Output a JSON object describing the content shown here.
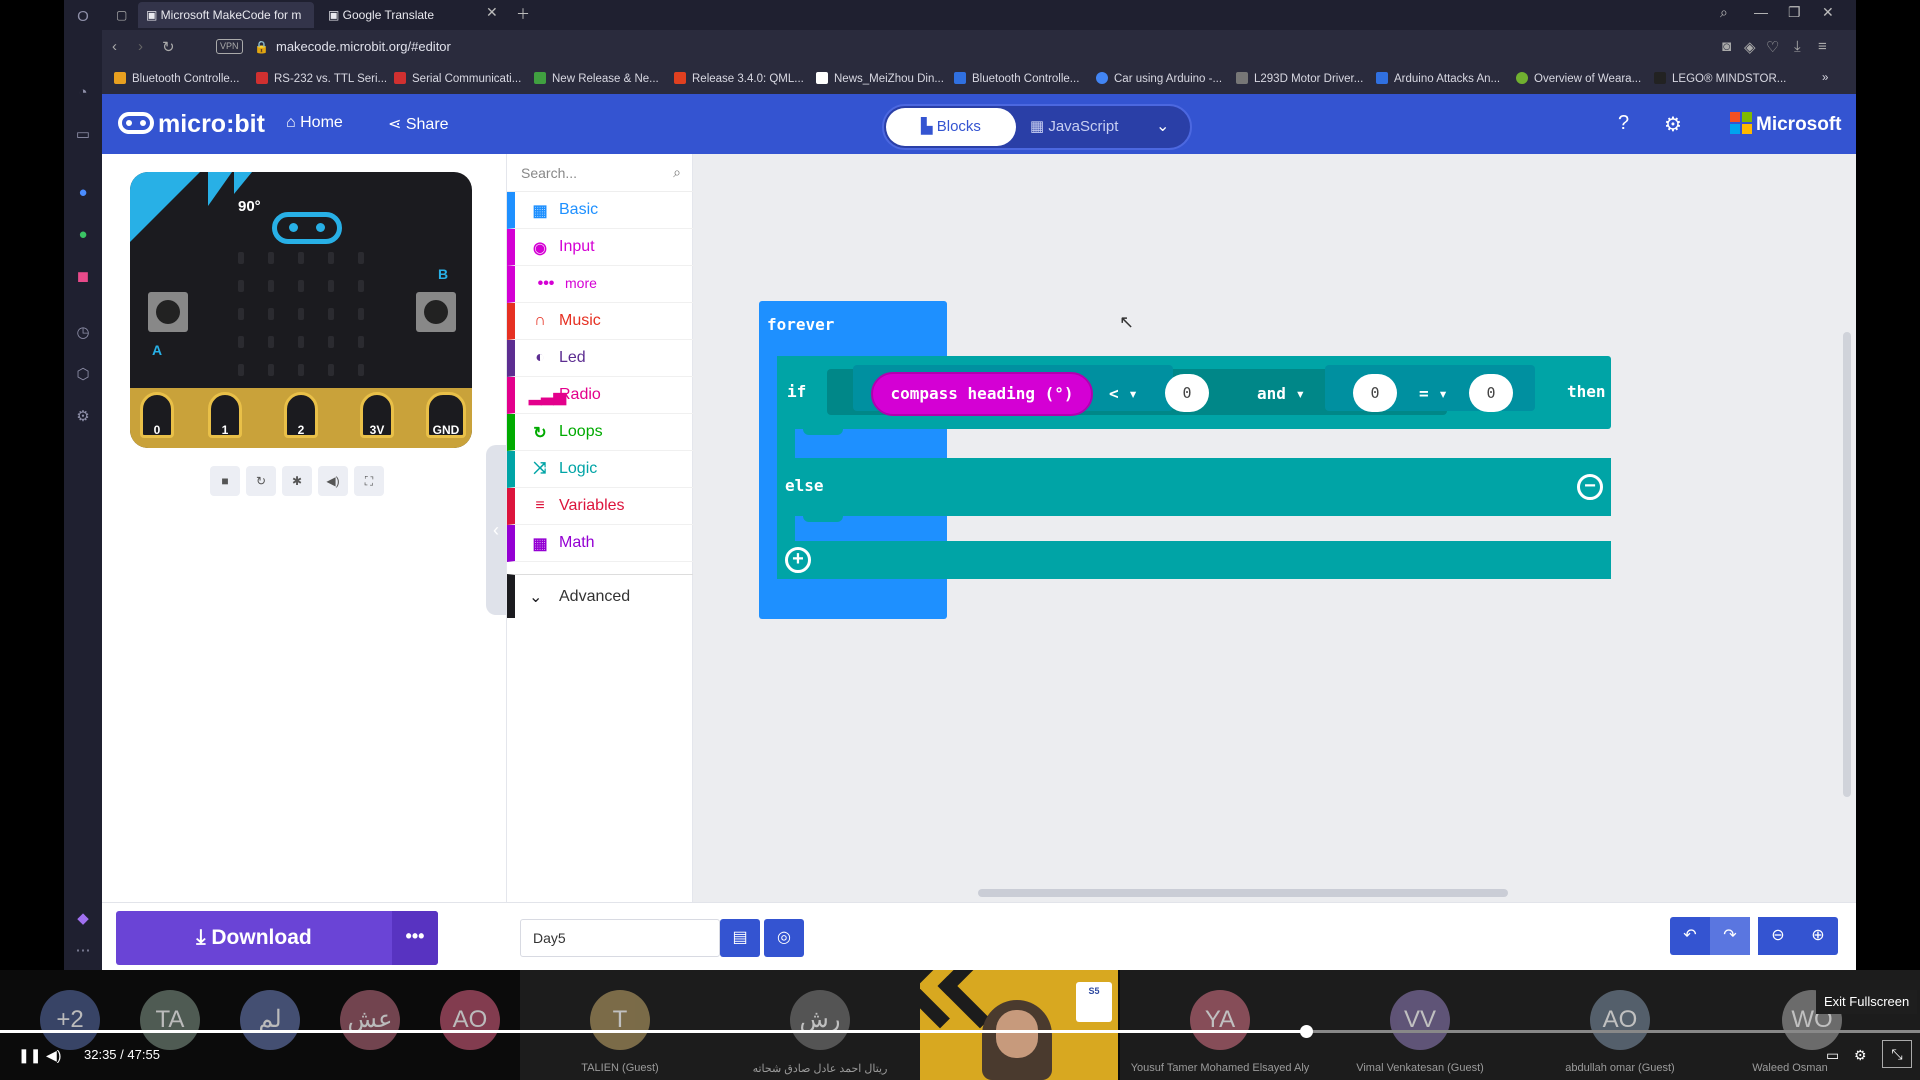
{
  "browser": {
    "tabs": [
      {
        "title": "Microsoft MakeCode for m",
        "active": true
      },
      {
        "title": "Google Translate",
        "active": false
      }
    ],
    "address": "makecode.microbit.org/#editor",
    "vpn_label": "VPN",
    "bookmarks": [
      {
        "label": "Bluetooth Controlle...",
        "color": "#e8a020"
      },
      {
        "label": "RS-232 vs. TTL Seri...",
        "color": "#d03030"
      },
      {
        "label": "Serial Communicati...",
        "color": "#d03030"
      },
      {
        "label": "New Release & Ne...",
        "color": "#40a040"
      },
      {
        "label": "Release 3.4.0: QML...",
        "color": "#e04020"
      },
      {
        "label": "News_MeiZhou Din...",
        "color": "#ffffff"
      },
      {
        "label": "Bluetooth Controlle...",
        "color": "#3070e0"
      },
      {
        "label": "Car using Arduino -...",
        "color": "#4285f4"
      },
      {
        "label": "L293D Motor Driver...",
        "color": "#777777"
      },
      {
        "label": "Arduino Attacks An...",
        "color": "#3070e0"
      },
      {
        "label": "Overview of Weara...",
        "color": "#70b030"
      },
      {
        "label": "LEGO® MINDSTOR...",
        "color": "#222222"
      }
    ]
  },
  "header": {
    "logo": "micro:bit",
    "home": "Home",
    "share": "Share",
    "blocks": "Blocks",
    "javascript": "JavaScript",
    "microsoft": "Microsoft"
  },
  "simulator": {
    "heading": "90°",
    "pins": [
      "0",
      "1",
      "2",
      "3V",
      "GND"
    ],
    "button_a": "A",
    "button_b": "B"
  },
  "toolbox": {
    "search_placeholder": "Search...",
    "categories": [
      {
        "label": "Basic",
        "icon": "grid-icon",
        "color": "#1e90ff"
      },
      {
        "label": "Input",
        "icon": "target-icon",
        "color": "#d400d4"
      },
      {
        "label": "more",
        "icon": "dots-icon",
        "color": "#d400d4"
      },
      {
        "label": "Music",
        "icon": "headphones-icon",
        "color": "#e63022"
      },
      {
        "label": "Led",
        "icon": "toggle-icon",
        "color": "#5c2d91"
      },
      {
        "label": "Radio",
        "icon": "signal-bars-icon",
        "color": "#e3008c"
      },
      {
        "label": "Loops",
        "icon": "loop-arrow-icon",
        "color": "#00aa00"
      },
      {
        "label": "Logic",
        "icon": "shuffle-icon",
        "color": "#00a4a6"
      },
      {
        "label": "Variables",
        "icon": "list-icon",
        "color": "#dc143c"
      },
      {
        "label": "Math",
        "icon": "calculator-icon",
        "color": "#9400d3"
      }
    ],
    "advanced": "Advanced"
  },
  "workspace": {
    "forever": "forever",
    "if": "if",
    "compass": "compass heading (°)",
    "op_lt": "<",
    "lhs_value": "0",
    "and": "and",
    "eq_left": "0",
    "op_eq": "=",
    "eq_right": "0",
    "then": "then",
    "else": "else"
  },
  "bottom": {
    "download": "Download",
    "project_name": "Day5"
  },
  "conference": {
    "participants": [
      {
        "initials": "+2",
        "name": "",
        "color": "#4a5a8a"
      },
      {
        "initials": "TA",
        "name": "",
        "color": "#6a7a70"
      },
      {
        "initials": "لم",
        "name": "",
        "color": "#5a6a9a"
      },
      {
        "initials": "عش",
        "name": "",
        "color": "#9a5a6a"
      },
      {
        "initials": "AO",
        "name": "",
        "color": "#b0506a"
      },
      {
        "initials": "T",
        "name": "TALIEN (Guest)",
        "color": "#a08a5a"
      },
      {
        "initials": "رش",
        "name": "ريتال احمد عادل صادق شحاته",
        "color": "#6a6a6a"
      },
      {
        "initials": "YA",
        "name": "Yousuf Tamer Mohamed Elsayed Aly",
        "color": "#b06070"
      },
      {
        "initials": "VV",
        "name": "Vimal Venkatesan (Guest)",
        "color": "#7a6a9a"
      },
      {
        "initials": "AO",
        "name": "abdullah omar (Guest)",
        "color": "#6a7a8a"
      },
      {
        "initials": "WO",
        "name": "Waleed Osman",
        "color": "#8a8a8a"
      }
    ],
    "time_current": "32:35",
    "time_sep": "/",
    "time_total": "47:55",
    "progress": 0.68,
    "tooltip": "Exit Fullscreen"
  }
}
